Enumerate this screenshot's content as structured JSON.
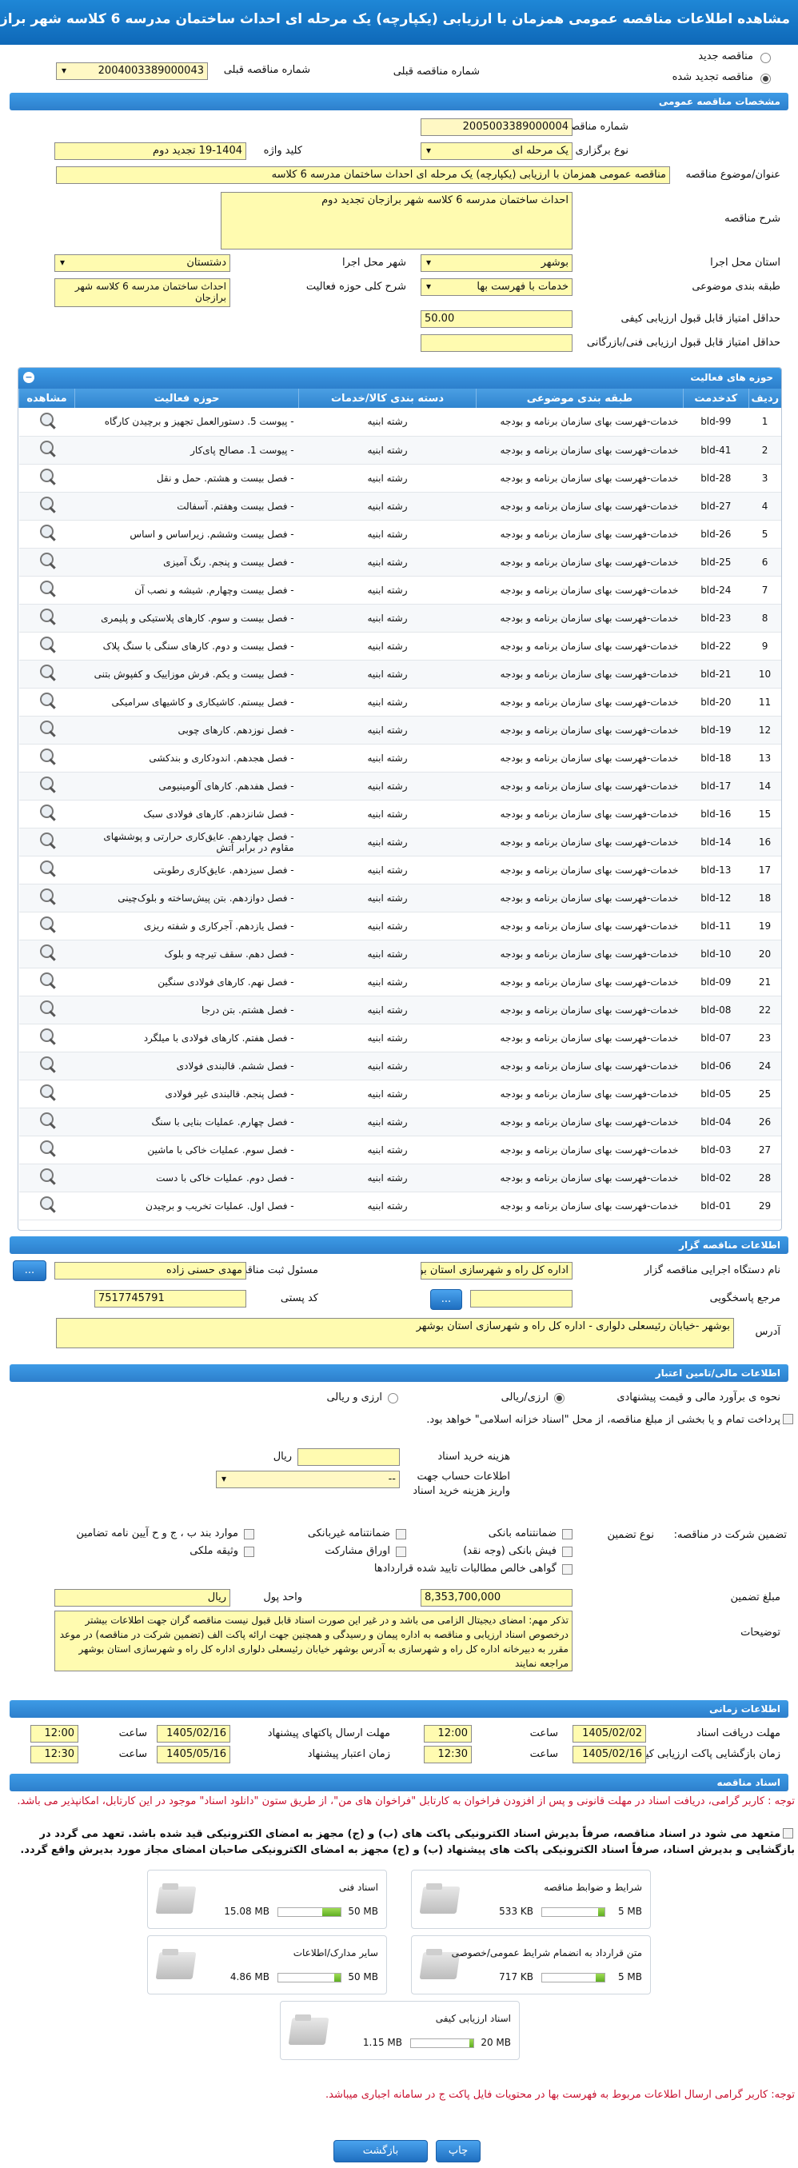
{
  "title": "مشاهده اطلاعات مناقصه عمومی همزمان با ارزیابی (یکپارچه) یک مرحله ای احداث ساختمان مدرسه 6 کلاسه شهر برازجان تجدید دوم",
  "top": {
    "new_label": "مناقصه جدید",
    "renewed_label": "مناقصه تجدید شده",
    "prev_number_label": "شماره مناقصه قبلی",
    "prev_number": "2004003389000043"
  },
  "general": {
    "section": "مشخصات مناقصه عمومی",
    "number_label": "شماره مناقصه",
    "number": "2005003389000004",
    "type_label": "نوع برگزاری",
    "type": "یک مرحله ای",
    "keyword_label": "کلید واژه",
    "keyword": "19-1404 تجدید دوم",
    "subject_label": "عنوان/موضوع مناقصه",
    "subject": "مناقصه عمومی همزمان با ارزیابی (یکپارچه) یک مرحله ای احداث ساختمان مدرسه 6 کلاسه",
    "desc_label": "شرح مناقصه",
    "desc": "احداث ساختمان مدرسه 6 کلاسه شهر برازجان تجدید دوم",
    "province_label": "استان محل اجرا",
    "province": "بوشهر",
    "city_label": "شهر محل اجرا",
    "city": "دشتستان",
    "category_label": "طبقه بندی موضوعی",
    "category": "خدمات با فهرست بها",
    "scope_label": "شرح کلی حوزه فعالیت",
    "scope": "احداث ساختمان مدرسه 6 کلاسه شهر برازجان",
    "min_quality_label": "حداقل امتیاز قابل قبول ارزیابی کیفی",
    "min_quality": "50.00",
    "min_tech_label": "حداقل امتیاز قابل قبول ارزیابی فنی/بازرگانی",
    "min_tech": ""
  },
  "activities": {
    "section": "حوزه های فعالیت",
    "columns": [
      "ردیف",
      "کدخدمت",
      "طبقه بندی موضوعی",
      "دسته بندی کالا/خدمات",
      "حوزه فعالیت",
      "مشاهده"
    ],
    "rows": [
      [
        "1",
        "bld-99",
        "خدمات-فهرست بهای سازمان برنامه و بودجه",
        "رشته ابنیه",
        "- پیوست 5. دستورالعمل تجهیز و برچیدن کارگاه"
      ],
      [
        "2",
        "bld-41",
        "خدمات-فهرست بهای سازمان برنامه و بودجه",
        "رشته ابنیه",
        "- پیوست 1. مصالح پای‌کار"
      ],
      [
        "3",
        "bld-28",
        "خدمات-فهرست بهای سازمان برنامه و بودجه",
        "رشته ابنیه",
        "- فصل بیست و هشتم. حمل و نقل"
      ],
      [
        "4",
        "bld-27",
        "خدمات-فهرست بهای سازمان برنامه و بودجه",
        "رشته ابنیه",
        "- فصل بیست وهفتم. آسفالت"
      ],
      [
        "5",
        "bld-26",
        "خدمات-فهرست بهای سازمان برنامه و بودجه",
        "رشته ابنیه",
        "- فصل بیست وششم. زیراساس و اساس"
      ],
      [
        "6",
        "bld-25",
        "خدمات-فهرست بهای سازمان برنامه و بودجه",
        "رشته ابنیه",
        "- فصل بیست و پنجم. رنگ آمیزی"
      ],
      [
        "7",
        "bld-24",
        "خدمات-فهرست بهای سازمان برنامه و بودجه",
        "رشته ابنیه",
        "- فصل بیست وچهارم. شیشه و نصب آن"
      ],
      [
        "8",
        "bld-23",
        "خدمات-فهرست بهای سازمان برنامه و بودجه",
        "رشته ابنیه",
        "- فصل بیست و سوم. کارهای پلاستیکی و پلیمری"
      ],
      [
        "9",
        "bld-22",
        "خدمات-فهرست بهای سازمان برنامه و بودجه",
        "رشته ابنیه",
        "- فصل بیست و دوم. کارهای سنگی با سنگ پلاک"
      ],
      [
        "10",
        "bld-21",
        "خدمات-فهرست بهای سازمان برنامه و بودجه",
        "رشته ابنیه",
        "- فصل بیست و یکم. فرش موزاییک و کفپوش بتنی"
      ],
      [
        "11",
        "bld-20",
        "خدمات-فهرست بهای سازمان برنامه و بودجه",
        "رشته ابنیه",
        "- فصل بیستم. کاشیکاری و کاشیهای سرامیکی"
      ],
      [
        "12",
        "bld-19",
        "خدمات-فهرست بهای سازمان برنامه و بودجه",
        "رشته ابنیه",
        "- فصل نوزدهم. کارهای چوبی"
      ],
      [
        "13",
        "bld-18",
        "خدمات-فهرست بهای سازمان برنامه و بودجه",
        "رشته ابنیه",
        "- فصل هجدهم. اندودکاری و بندکشی"
      ],
      [
        "14",
        "bld-17",
        "خدمات-فهرست بهای سازمان برنامه و بودجه",
        "رشته ابنیه",
        "- فصل هفدهم. کارهای آلومینیومی"
      ],
      [
        "15",
        "bld-16",
        "خدمات-فهرست بهای سازمان برنامه و بودجه",
        "رشته ابنیه",
        "- فصل شانزدهم. کارهای فولادی سبک"
      ],
      [
        "16",
        "bld-14",
        "خدمات-فهرست بهای سازمان برنامه و بودجه",
        "رشته ابنیه",
        "- فصل چهاردهم. عایق‌کاری حرارتی و پوششهای مقاوم در برابر آتش"
      ],
      [
        "17",
        "bld-13",
        "خدمات-فهرست بهای سازمان برنامه و بودجه",
        "رشته ابنیه",
        "- فصل سیزدهم. عایق‌کاری رطوبتی"
      ],
      [
        "18",
        "bld-12",
        "خدمات-فهرست بهای سازمان برنامه و بودجه",
        "رشته ابنیه",
        "- فصل دوازدهم. بتن پیش‌ساخته و بلوک‌چینی"
      ],
      [
        "19",
        "bld-11",
        "خدمات-فهرست بهای سازمان برنامه و بودجه",
        "رشته ابنیه",
        "- فصل یازدهم. آجرکاری و شفته ریزی"
      ],
      [
        "20",
        "bld-10",
        "خدمات-فهرست بهای سازمان برنامه و بودجه",
        "رشته ابنیه",
        "- فصل دهم. سقف تیرچه و بلوک"
      ],
      [
        "21",
        "bld-09",
        "خدمات-فهرست بهای سازمان برنامه و بودجه",
        "رشته ابنیه",
        "- فصل نهم. کارهای فولادی سنگین"
      ],
      [
        "22",
        "bld-08",
        "خدمات-فهرست بهای سازمان برنامه و بودجه",
        "رشته ابنیه",
        "- فصل هشتم. بتن درجا"
      ],
      [
        "23",
        "bld-07",
        "خدمات-فهرست بهای سازمان برنامه و بودجه",
        "رشته ابنیه",
        "- فصل هفتم. کارهای فولادی با میلگرد"
      ],
      [
        "24",
        "bld-06",
        "خدمات-فهرست بهای سازمان برنامه و بودجه",
        "رشته ابنیه",
        "- فصل ششم. قالبندی فولادی"
      ],
      [
        "25",
        "bld-05",
        "خدمات-فهرست بهای سازمان برنامه و بودجه",
        "رشته ابنیه",
        "- فصل پنجم. قالبندی غیر فولادی"
      ],
      [
        "26",
        "bld-04",
        "خدمات-فهرست بهای سازمان برنامه و بودجه",
        "رشته ابنیه",
        "- فصل چهارم. عملیات بنایی با سنگ"
      ],
      [
        "27",
        "bld-03",
        "خدمات-فهرست بهای سازمان برنامه و بودجه",
        "رشته ابنیه",
        "- فصل سوم. عملیات خاکی با ماشین"
      ],
      [
        "28",
        "bld-02",
        "خدمات-فهرست بهای سازمان برنامه و بودجه",
        "رشته ابنیه",
        "- فصل دوم. عملیات خاکی با دست"
      ],
      [
        "29",
        "bld-01",
        "خدمات-فهرست بهای سازمان برنامه و بودجه",
        "رشته ابنیه",
        "- فصل اول. عملیات تخریب و برچیدن"
      ]
    ]
  },
  "organizer": {
    "section": "اطلاعات مناقصه گزار",
    "org_label": "نام دستگاه اجرایی مناقصه گزار",
    "org": "اداره کل راه و شهرسازی استان بوشهر",
    "resp_label": "مسئول ثبت مناقصه",
    "resp": "مهدی حسنی زاده",
    "ref_label": "مرجع پاسخگویی",
    "ref": "",
    "postal_label": "کد پستی",
    "postal": "7517745791",
    "address_label": "آدرس",
    "address": "بوشهر -خیابان رئیسعلی دلواری - اداره کل راه و شهرسازی استان بوشهر",
    "btn": "..."
  },
  "finance": {
    "section": "اطلاعات مالی/تامین اعتبار",
    "estimate_label": "نحوه ی برآورد مالی و قیمت پیشنهادی",
    "opt1": "ارزی/ریالی",
    "opt2": "ارزی و ریالی",
    "treasury_text": "پرداخت تمام و یا بخشی از مبلغ مناقصه، از محل \"اسناد خزانه اسلامی\" خواهد بود.",
    "doc_fee_label": "هزینه خرید اسناد",
    "doc_fee": "",
    "rial": "ریال",
    "account_label": "اطلاعات حساب جهت واریز هزینه خرید اسناد",
    "account": "--",
    "guarantee_label": "تضمین شرکت در مناقصه:",
    "guarantee_type_label": "نوع تضمین",
    "g1": "ضمانتنامه بانکی",
    "g2": "ضمانتنامه غیربانکی",
    "g3": "موارد بند ب ، ج و ح آیین نامه تضامین",
    "g4": "فیش بانکی (وجه نقد)",
    "g5": "اوراق مشارکت",
    "g6": "وثیقه ملکی",
    "g7": "گواهی خالص مطالبات تایید شده قراردادها",
    "amount_label": "مبلغ تضمین",
    "amount": "8,353,700,000",
    "currency_label": "واحد پول",
    "currency": "ریال",
    "notes_label": "توضیحات",
    "notes": "تذکر مهم: امضای دیجیتال الزامی می باشد و در غیر این صورت اسناد قابل قبول نیست مناقصه گران جهت اطلاعات بیشتر درخصوص اسناد ارزیابی و مناقصه به اداره پیمان و رسیدگی و همچنین جهت ارائه پاکت الف (تضمین شرکت در مناقصه) در موعد مقرر به دبیرخانه اداره کل راه و شهرسازی به آدرس بوشهر خیابان رئیسعلی دلواری اداره کل راه و شهرسازی استان بوشهر مراجعه نمایند"
  },
  "timing": {
    "section": "اطلاعات زمانی",
    "receive_label": "مهلت دریافت اسناد",
    "receive_date": "1405/02/02",
    "receive_time": "12:00",
    "send_label": "مهلت ارسال پاکتهای پیشنهاد",
    "send_date": "1405/02/16",
    "send_time": "12:00",
    "open_label": "زمان بازگشایی پاکت ارزیابی کیفی",
    "open_date": "1405/02/16",
    "open_time": "12:30",
    "valid_label": "زمان اعتبار پیشنهاد",
    "valid_date": "1405/05/16",
    "valid_time": "12:30",
    "time_label": "ساعت"
  },
  "docs": {
    "section": "اسناد مناقصه",
    "notice1": "توجه : کاربر گرامی، دریافت اسناد در مهلت قانونی و پس از افزودن فراخوان به کارتابل \"فراخوان های من\"، از طریق ستون \"دانلود اسناد\" موجود در این کارتابل، امکانپذیر می باشد.",
    "commit": "متعهد می شود در اسناد مناقصه، صرفاً بدیرش اسناد الکترونیکی پاکت های (ب) و (ج) مجهز به امضای الکترونیکی قید شده باشد. تعهد می گردد در بازگشایی و بدیرش اسناد، صرفاً اسناد الکترونیکی پاکت های پیشنهاد (ب) و (ج) مجهز به امضای الکترونیکی صاحبان امضای مجاز مورد بدیرش واقع گردد.",
    "items": [
      {
        "name": "شرایط و ضوابط مناقصه",
        "size": "533 KB",
        "max": "5 MB",
        "fill": 0.1
      },
      {
        "name": "اسناد فنی",
        "size": "15.08 MB",
        "max": "50 MB",
        "fill": 0.3
      },
      {
        "name": "متن قرارداد به انضمام شرایط عمومی/خصوصی",
        "size": "717 KB",
        "max": "5 MB",
        "fill": 0.14
      },
      {
        "name": "سایر مدارک/اطلاعات",
        "size": "4.86 MB",
        "max": "50 MB",
        "fill": 0.1
      },
      {
        "name": "اسناد ارزیابی کیفی",
        "size": "1.15 MB",
        "max": "20 MB",
        "fill": 0.06
      }
    ],
    "notice2": "توجه: کاربر گرامی ارسال اطلاعات مربوط به فهرست بها در محتویات فایل پاکت ج در سامانه اجباری میباشد."
  },
  "actions": {
    "print": "چاپ",
    "back": "بازگشت"
  }
}
